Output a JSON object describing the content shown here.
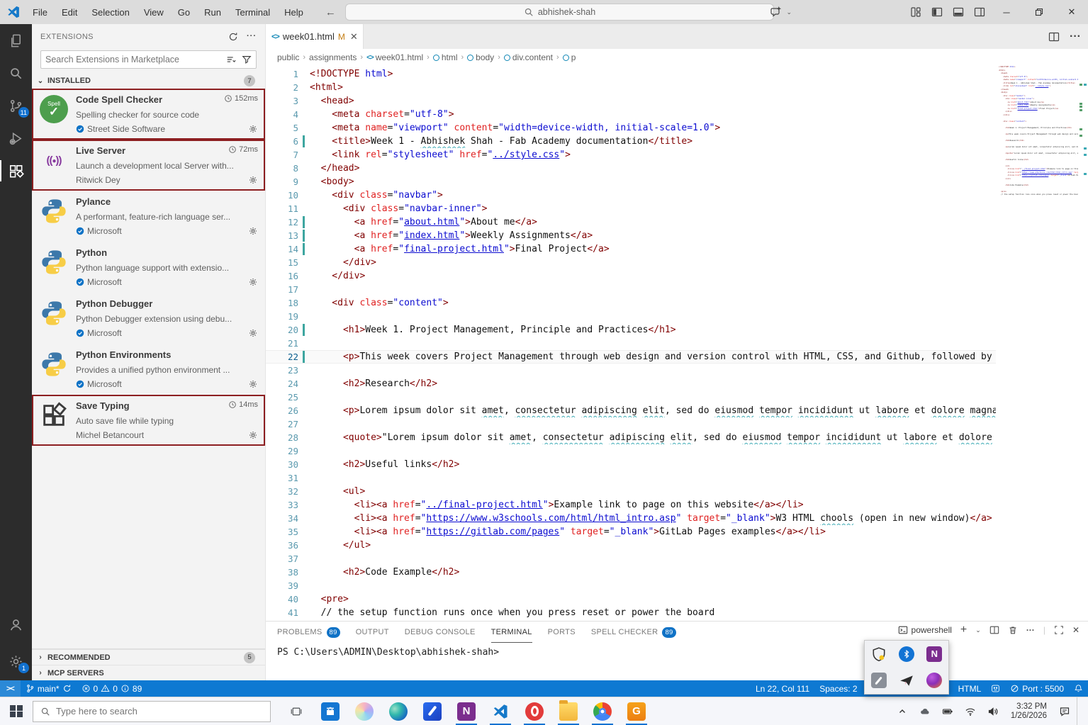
{
  "window": {
    "menus": [
      "File",
      "Edit",
      "Selection",
      "View",
      "Go",
      "Run",
      "Terminal",
      "Help"
    ],
    "search_value": "abhishek-shah"
  },
  "activity_bar": {
    "scm_badge": "11",
    "settings_badge": "1"
  },
  "sidebar": {
    "title": "EXTENSIONS",
    "search_placeholder": "Search Extensions in Marketplace",
    "installed_label": "INSTALLED",
    "installed_count": "7",
    "recommended_label": "RECOMMENDED",
    "recommended_count": "5",
    "mcp_label": "MCP SERVERS",
    "extensions": [
      {
        "name": "Code Spell Checker",
        "time": "152ms",
        "desc": "Spelling checker for source code",
        "publisher": "Street Side Software",
        "verified": true,
        "icon": "spell",
        "highlighted": true
      },
      {
        "name": "Live Server",
        "time": "72ms",
        "desc": "Launch a development local Server with...",
        "publisher": "Ritwick Dey",
        "verified": false,
        "icon": "live",
        "highlighted": true
      },
      {
        "name": "Pylance",
        "desc": "A performant, feature-rich language ser...",
        "publisher": "Microsoft",
        "verified": true,
        "icon": "python"
      },
      {
        "name": "Python",
        "desc": "Python language support with extensio...",
        "publisher": "Microsoft",
        "verified": true,
        "icon": "python"
      },
      {
        "name": "Python Debugger",
        "desc": "Python Debugger extension using debu...",
        "publisher": "Microsoft",
        "verified": true,
        "icon": "python"
      },
      {
        "name": "Python Environments",
        "desc": "Provides a unified python environment ...",
        "publisher": "Microsoft",
        "verified": true,
        "icon": "python"
      },
      {
        "name": "Save Typing",
        "time": "14ms",
        "desc": "Auto save file while typing",
        "publisher": "Michel Betancourt",
        "verified": false,
        "icon": "save",
        "highlighted": true
      }
    ]
  },
  "editor": {
    "tab": {
      "name": "week01.html",
      "modified_mark": "M"
    },
    "breadcrumbs": [
      {
        "label": "public",
        "icon": ""
      },
      {
        "label": "assignments",
        "icon": ""
      },
      {
        "label": "week01.html",
        "icon": "code"
      },
      {
        "label": "html",
        "icon": "symbol"
      },
      {
        "label": "body",
        "icon": "symbol"
      },
      {
        "label": "div.content",
        "icon": "symbol"
      },
      {
        "label": "p",
        "icon": "symbol"
      }
    ],
    "cursor_line": 22,
    "modified_lines": [
      6,
      12,
      13,
      14,
      20,
      22
    ],
    "spell_lines": [
      6,
      26,
      28,
      34
    ],
    "lines": [
      {
        "n": 1,
        "segs": [
          [
            "t",
            "<!DOCTYPE "
          ],
          [
            "v",
            "html"
          ],
          [
            "t",
            ">"
          ]
        ]
      },
      {
        "n": 2,
        "segs": [
          [
            "t",
            "<html>"
          ]
        ]
      },
      {
        "n": 3,
        "segs": [
          [
            "t",
            "  <head>"
          ]
        ]
      },
      {
        "n": 4,
        "segs": [
          [
            "t",
            "    <meta "
          ],
          [
            "a",
            "charset"
          ],
          [
            "x",
            "="
          ],
          [
            "v",
            "\"utf-8\""
          ],
          [
            "t",
            ">"
          ]
        ]
      },
      {
        "n": 5,
        "segs": [
          [
            "t",
            "    <meta "
          ],
          [
            "a",
            "name"
          ],
          [
            "x",
            "="
          ],
          [
            "v",
            "\"viewport\""
          ],
          [
            "a",
            " content"
          ],
          [
            "x",
            "="
          ],
          [
            "v",
            "\"width=device-width, initial-scale=1.0\""
          ],
          [
            "t",
            ">"
          ]
        ]
      },
      {
        "n": 6,
        "segs": [
          [
            "t",
            "    <title>"
          ],
          [
            "x",
            "Week 1 - "
          ],
          [
            "s",
            "Abhishek"
          ],
          [
            "x",
            " Shah - Fab Academy documentation"
          ],
          [
            "t",
            "</title>"
          ]
        ]
      },
      {
        "n": 7,
        "segs": [
          [
            "t",
            "    <link "
          ],
          [
            "a",
            "rel"
          ],
          [
            "x",
            "="
          ],
          [
            "v",
            "\"stylesheet\""
          ],
          [
            "a",
            " href"
          ],
          [
            "x",
            "="
          ],
          [
            "v",
            "\""
          ],
          [
            "u",
            "../style.css"
          ],
          [
            "v",
            "\""
          ],
          [
            "t",
            ">"
          ]
        ]
      },
      {
        "n": 8,
        "segs": [
          [
            "t",
            "  </head>"
          ]
        ]
      },
      {
        "n": 9,
        "segs": [
          [
            "t",
            "  <body>"
          ]
        ]
      },
      {
        "n": 10,
        "segs": [
          [
            "t",
            "    <div "
          ],
          [
            "a",
            "class"
          ],
          [
            "x",
            "="
          ],
          [
            "v",
            "\"navbar\""
          ],
          [
            "t",
            ">"
          ]
        ]
      },
      {
        "n": 11,
        "segs": [
          [
            "t",
            "      <div "
          ],
          [
            "a",
            "class"
          ],
          [
            "x",
            "="
          ],
          [
            "v",
            "\"navbar-inner\""
          ],
          [
            "t",
            ">"
          ]
        ]
      },
      {
        "n": 12,
        "segs": [
          [
            "t",
            "        <a "
          ],
          [
            "a",
            "href"
          ],
          [
            "x",
            "="
          ],
          [
            "v",
            "\""
          ],
          [
            "u",
            "about.html"
          ],
          [
            "v",
            "\""
          ],
          [
            "t",
            ">"
          ],
          [
            "x",
            "About me"
          ],
          [
            "t",
            "</a>"
          ]
        ]
      },
      {
        "n": 13,
        "segs": [
          [
            "t",
            "        <a "
          ],
          [
            "a",
            "href"
          ],
          [
            "x",
            "="
          ],
          [
            "v",
            "\""
          ],
          [
            "u",
            "index.html"
          ],
          [
            "v",
            "\""
          ],
          [
            "t",
            ">"
          ],
          [
            "x",
            "Weekly Assignments"
          ],
          [
            "t",
            "</a>"
          ]
        ]
      },
      {
        "n": 14,
        "segs": [
          [
            "t",
            "        <a "
          ],
          [
            "a",
            "href"
          ],
          [
            "x",
            "="
          ],
          [
            "v",
            "\""
          ],
          [
            "u",
            "final-project.html"
          ],
          [
            "v",
            "\""
          ],
          [
            "t",
            ">"
          ],
          [
            "x",
            "Final Project"
          ],
          [
            "t",
            "</a>"
          ]
        ]
      },
      {
        "n": 15,
        "segs": [
          [
            "t",
            "      </div>"
          ]
        ]
      },
      {
        "n": 16,
        "segs": [
          [
            "t",
            "    </div>"
          ]
        ]
      },
      {
        "n": 17,
        "segs": []
      },
      {
        "n": 18,
        "segs": [
          [
            "t",
            "    <div "
          ],
          [
            "a",
            "class"
          ],
          [
            "x",
            "="
          ],
          [
            "v",
            "\"content\""
          ],
          [
            "t",
            ">"
          ]
        ]
      },
      {
        "n": 19,
        "segs": []
      },
      {
        "n": 20,
        "segs": [
          [
            "t",
            "      <h1>"
          ],
          [
            "x",
            "Week 1. Project Management, Principle and Practices"
          ],
          [
            "t",
            "</h1>"
          ]
        ]
      },
      {
        "n": 21,
        "segs": []
      },
      {
        "n": 22,
        "segs": [
          [
            "t",
            "      <p>"
          ],
          [
            "x",
            "This week covers Project Management through web design and version control with HTML, CSS, and Github, followed by P"
          ]
        ]
      },
      {
        "n": 23,
        "segs": []
      },
      {
        "n": 24,
        "segs": [
          [
            "t",
            "      <h2>"
          ],
          [
            "x",
            "Research"
          ],
          [
            "t",
            "</h2>"
          ]
        ]
      },
      {
        "n": 25,
        "segs": []
      },
      {
        "n": 26,
        "segs": [
          [
            "t",
            "      <p>"
          ],
          [
            "x",
            "Lorem ipsum dolor sit "
          ],
          [
            "s",
            "amet"
          ],
          [
            "x",
            ", "
          ],
          [
            "s",
            "consectetur"
          ],
          [
            "x",
            " "
          ],
          [
            "s",
            "adipiscing"
          ],
          [
            "x",
            " "
          ],
          [
            "s",
            "elit"
          ],
          [
            "x",
            ", sed do "
          ],
          [
            "s",
            "eiusmod"
          ],
          [
            "x",
            " "
          ],
          [
            "s",
            "tempor"
          ],
          [
            "x",
            " "
          ],
          [
            "s",
            "incididunt"
          ],
          [
            "x",
            " ut "
          ],
          [
            "s",
            "labore"
          ],
          [
            "x",
            " et "
          ],
          [
            "s",
            "dolore"
          ],
          [
            "x",
            " "
          ],
          [
            "s",
            "magna"
          ],
          [
            "x",
            " "
          ]
        ]
      },
      {
        "n": 27,
        "segs": []
      },
      {
        "n": 28,
        "segs": [
          [
            "t",
            "      <quote>"
          ],
          [
            "x",
            "\"Lorem ipsum dolor sit "
          ],
          [
            "s",
            "amet"
          ],
          [
            "x",
            ", "
          ],
          [
            "s",
            "consectetur"
          ],
          [
            "x",
            " "
          ],
          [
            "s",
            "adipiscing"
          ],
          [
            "x",
            " "
          ],
          [
            "s",
            "elit"
          ],
          [
            "x",
            ", sed do "
          ],
          [
            "s",
            "eiusmod"
          ],
          [
            "x",
            " "
          ],
          [
            "s",
            "tempor"
          ],
          [
            "x",
            " "
          ],
          [
            "s",
            "incididunt"
          ],
          [
            "x",
            " ut "
          ],
          [
            "s",
            "labore"
          ],
          [
            "x",
            " et "
          ],
          [
            "s",
            "dolore"
          ],
          [
            "x",
            " m"
          ]
        ]
      },
      {
        "n": 29,
        "segs": []
      },
      {
        "n": 30,
        "segs": [
          [
            "t",
            "      <h2>"
          ],
          [
            "x",
            "Useful links"
          ],
          [
            "t",
            "</h2>"
          ]
        ]
      },
      {
        "n": 31,
        "segs": []
      },
      {
        "n": 32,
        "segs": [
          [
            "t",
            "      <ul>"
          ]
        ]
      },
      {
        "n": 33,
        "segs": [
          [
            "t",
            "        <li><a "
          ],
          [
            "a",
            "href"
          ],
          [
            "x",
            "="
          ],
          [
            "v",
            "\""
          ],
          [
            "u",
            "../final-project.html"
          ],
          [
            "v",
            "\""
          ],
          [
            "t",
            ">"
          ],
          [
            "x",
            "Example link to page on this website"
          ],
          [
            "t",
            "</a></li>"
          ]
        ]
      },
      {
        "n": 34,
        "segs": [
          [
            "t",
            "        <li><a "
          ],
          [
            "a",
            "href"
          ],
          [
            "x",
            "="
          ],
          [
            "v",
            "\""
          ],
          [
            "u",
            "https://www.w3schools.com/html/html_intro.asp"
          ],
          [
            "v",
            "\""
          ],
          [
            "a",
            " target"
          ],
          [
            "x",
            "="
          ],
          [
            "v",
            "\"_blank\""
          ],
          [
            "t",
            ">"
          ],
          [
            "x",
            "W3 HTML "
          ],
          [
            "s",
            "chools"
          ],
          [
            "x",
            " (open in new window)"
          ],
          [
            "t",
            "</a>"
          ]
        ]
      },
      {
        "n": 35,
        "segs": [
          [
            "t",
            "        <li><a "
          ],
          [
            "a",
            "href"
          ],
          [
            "x",
            "="
          ],
          [
            "v",
            "\""
          ],
          [
            "u",
            "https://gitlab.com/pages"
          ],
          [
            "v",
            "\""
          ],
          [
            "a",
            " target"
          ],
          [
            "x",
            "="
          ],
          [
            "v",
            "\"_blank\""
          ],
          [
            "t",
            ">"
          ],
          [
            "x",
            "GitLab Pages examples"
          ],
          [
            "t",
            "</a></li>"
          ]
        ]
      },
      {
        "n": 36,
        "segs": [
          [
            "t",
            "      </ul>"
          ]
        ]
      },
      {
        "n": 37,
        "segs": []
      },
      {
        "n": 38,
        "segs": [
          [
            "t",
            "      <h2>"
          ],
          [
            "x",
            "Code Example"
          ],
          [
            "t",
            "</h2>"
          ]
        ]
      },
      {
        "n": 39,
        "segs": []
      },
      {
        "n": 40,
        "segs": [
          [
            "t",
            "  <pre>"
          ]
        ]
      },
      {
        "n": 41,
        "segs": [
          [
            "x",
            "  // the setup function runs once when you press reset or power the board"
          ]
        ]
      }
    ]
  },
  "panel": {
    "tabs": [
      {
        "label": "PROBLEMS",
        "badge": "89"
      },
      {
        "label": "OUTPUT"
      },
      {
        "label": "DEBUG CONSOLE"
      },
      {
        "label": "TERMINAL",
        "active": true
      },
      {
        "label": "PORTS"
      },
      {
        "label": "SPELL CHECKER",
        "badge": "89"
      }
    ],
    "shell_label": "powershell",
    "terminal_prompt": "PS C:\\Users\\ADMIN\\Desktop\\abhishek-shah>"
  },
  "status_bar": {
    "branch": "main*",
    "errors": "0",
    "warnings": "0",
    "infos": "89",
    "line_col": "Ln 22, Col 111",
    "indent": "Spaces: 2",
    "language": "HTML",
    "live_server": "Port : 5500"
  },
  "taskbar": {
    "search_placeholder": "Type here to search",
    "apps": [
      {
        "id": "task-view",
        "running": false
      },
      {
        "id": "store",
        "running": false
      },
      {
        "id": "copilot",
        "running": false
      },
      {
        "id": "edge",
        "running": false
      },
      {
        "id": "journal",
        "running": false
      },
      {
        "id": "onenote",
        "running": true
      },
      {
        "id": "vscode",
        "running": true
      },
      {
        "id": "opera",
        "running": true
      },
      {
        "id": "explorer",
        "running": true
      },
      {
        "id": "chrome",
        "running": true
      },
      {
        "id": "idm",
        "running": true
      }
    ],
    "time": "3:32 PM",
    "date": "1/26/2026"
  },
  "tray_flyout": {
    "icons": [
      "security-shield",
      "bluetooth",
      "onenote",
      "snip",
      "telegram",
      "browser"
    ]
  },
  "colors": {
    "statusbar": "#0e79d2",
    "highlight_box": "#8d1f21",
    "badge": "#1072c6"
  }
}
